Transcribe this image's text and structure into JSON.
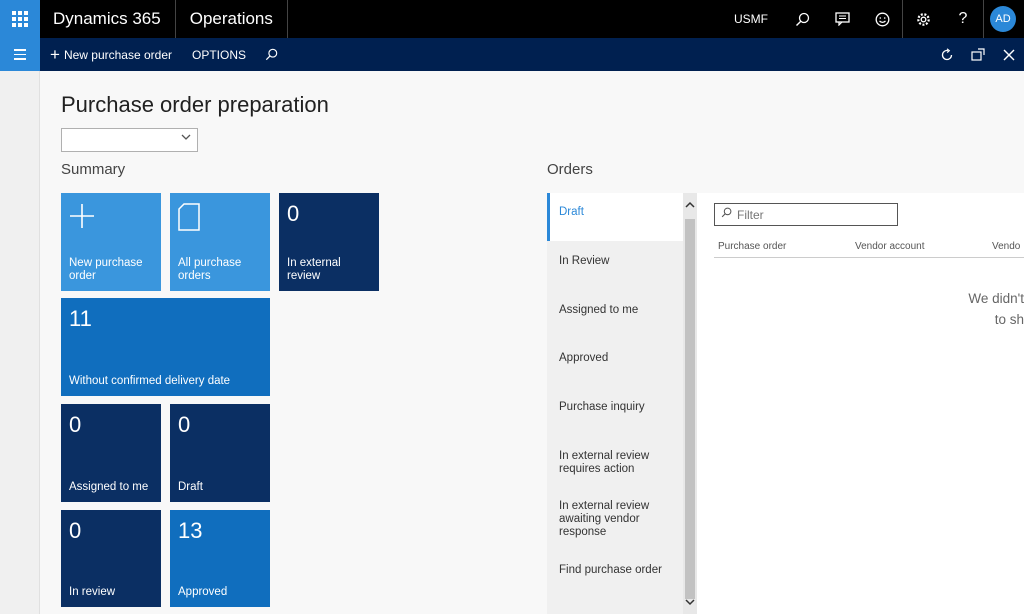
{
  "topbar": {
    "brand": "Dynamics 365",
    "module": "Operations",
    "company": "USMF",
    "avatar": "AD",
    "icons": [
      "search-icon",
      "chat-icon",
      "smiley-icon",
      "gear-icon",
      "help-icon"
    ]
  },
  "actionbar": {
    "new_label": "New purchase order",
    "options_label": "OPTIONS",
    "icons": [
      "refresh-icon",
      "open-in-new-icon",
      "close-icon"
    ]
  },
  "page": {
    "title": "Purchase order preparation"
  },
  "summary": {
    "title": "Summary",
    "tiles": {
      "new": {
        "label": "New purchase order"
      },
      "all": {
        "label": "All purchase orders"
      },
      "external": {
        "count": "0",
        "label": "In external review"
      },
      "unconfirmed": {
        "count": "11",
        "label": "Without confirmed delivery date"
      },
      "assigned": {
        "count": "0",
        "label": "Assigned to me"
      },
      "draft": {
        "count": "0",
        "label": "Draft"
      },
      "inreview": {
        "count": "0",
        "label": "In review"
      },
      "approved": {
        "count": "13",
        "label": "Approved"
      }
    }
  },
  "orders": {
    "title": "Orders",
    "items": [
      "Draft",
      "In Review",
      "Assigned to me",
      "Approved",
      "Purchase inquiry",
      "In external review requires action",
      "In external review awaiting vendor response",
      "Find purchase order"
    ],
    "filter_placeholder": "Filter",
    "columns": [
      "Purchase order",
      "Vendor account",
      "Vendo"
    ],
    "empty_line1": "We didn't",
    "empty_line2": "to sh"
  },
  "colors": {
    "tile_light": "#3a96dd",
    "tile_mid": "#106ebe",
    "tile_dark": "#0b2f63",
    "actionbar": "#002050",
    "accent": "#2b88d8"
  }
}
